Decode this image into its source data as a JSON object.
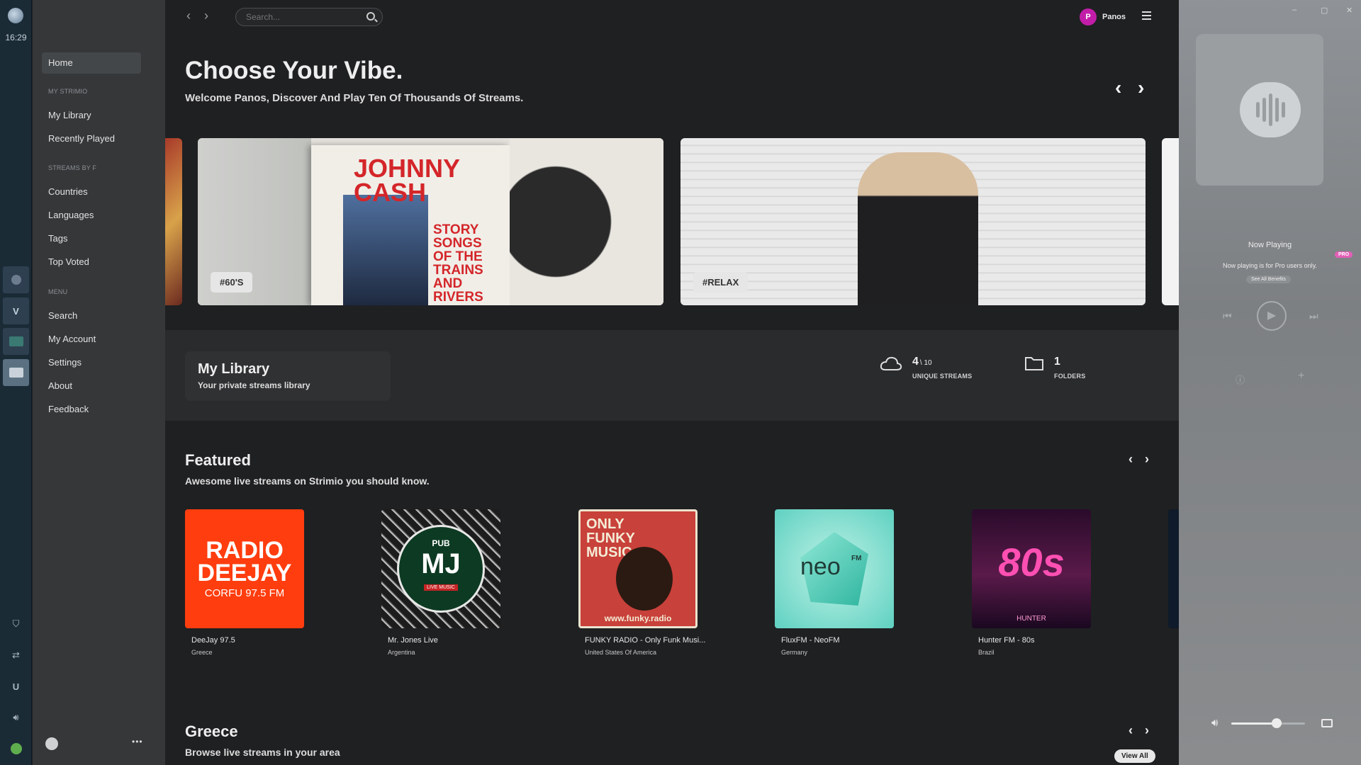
{
  "taskbar": {
    "clock": "16:29",
    "accent": "#1b2b36"
  },
  "sidebar": {
    "home": "Home",
    "my_strimio_header": "MY STRIMIO",
    "my_library": "My Library",
    "recently_played": "Recently Played",
    "streams_by_header": "STREAMS BY F",
    "countries": "Countries",
    "languages": "Languages",
    "tags": "Tags",
    "top_voted": "Top Voted",
    "menu_header": "MENU",
    "search": "Search",
    "my_account": "My Account",
    "settings": "Settings",
    "about": "About",
    "feedback": "Feedback",
    "more_glyph": "•••"
  },
  "header": {
    "search_placeholder": "Search...",
    "user_initial": "P",
    "user_name": "Panos"
  },
  "hero": {
    "title": "Choose Your Vibe.",
    "subtitle": "Welcome Panos, Discover And Play Ten Of Thousands Of Streams.",
    "cards": [
      {
        "tag": "#60'S",
        "art_text": "JOHNNY CASH",
        "art_sub": "STORY SONGS OF THE TRAINS AND RIVERS"
      },
      {
        "tag": "#RELAX"
      }
    ]
  },
  "library": {
    "title": "My Library",
    "subtitle": "Your private streams library",
    "streams_count": "4",
    "streams_max": "\\ 10",
    "streams_label": "UNIQUE STREAMS",
    "folders_count": "1",
    "folders_label": "FOLDERS"
  },
  "featured": {
    "title": "Featured",
    "subtitle": "Awesome live streams on Strimio you should know.",
    "stations": [
      {
        "name": "DeeJay 97.5",
        "country": "Greece",
        "art_line1": "RADIO",
        "art_line2": "DEEJAY",
        "art_line3": "CORFU 97.5 FM",
        "color": "#ff3d0e"
      },
      {
        "name": "Mr. Jones Live",
        "country": "Argentina",
        "art_line1": "PUB",
        "art_line2": "MJ",
        "art_line3": "LIVE MUSIC",
        "color": "#1b1b1b"
      },
      {
        "name": "FUNKY RADIO - Only Funk Musi...",
        "country": "United States Of America",
        "art_line1": "ONLY FUNKY MUSIC",
        "art_line3": "www.funky.radio",
        "color": "#c8413a"
      },
      {
        "name": "FluxFM - NeoFM",
        "country": "Germany",
        "art_line1": "neo",
        "art_line2": "FM",
        "color": "#5fd1c1"
      },
      {
        "name": "Hunter FM - 80s",
        "country": "Brazil",
        "art_line1": "80s",
        "art_line3": "HUNTER",
        "color": "#3a0f33"
      }
    ]
  },
  "greece": {
    "title": "Greece",
    "subtitle": "Browse live streams in your area",
    "view_all": "View All"
  },
  "player": {
    "now_playing": "Now Playing",
    "pro_badge": "PRO",
    "pro_message": "Now playing is for Pro users only.",
    "see_benefits": "See All Benefits",
    "volume_level": 0.62
  }
}
